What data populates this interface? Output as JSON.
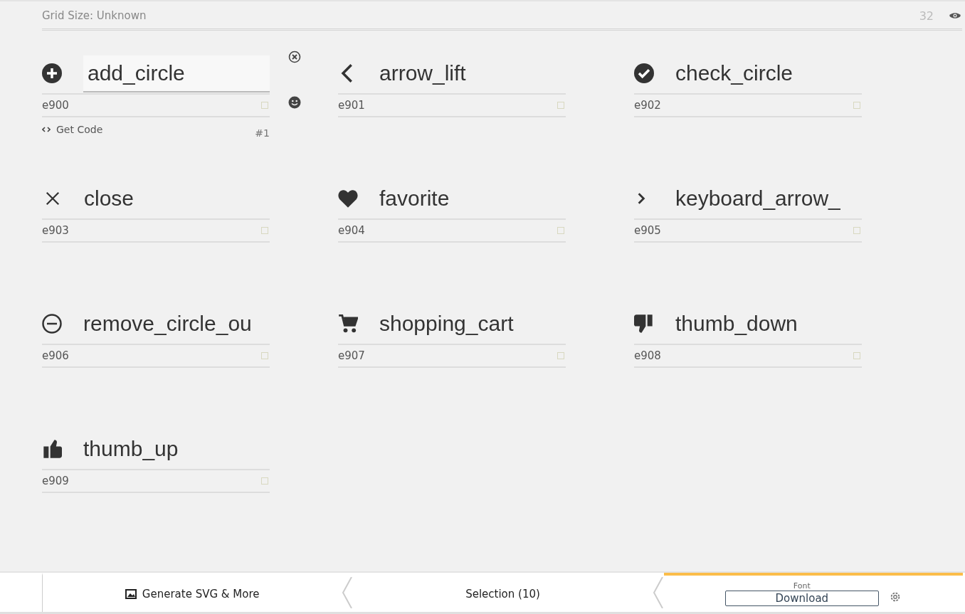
{
  "header": {
    "grid_size": "Grid Size: Unknown",
    "size": "32"
  },
  "glyphs": [
    {
      "kind": "plus_circle",
      "name": "add_circle",
      "code": "e900",
      "checked": false,
      "selected": true,
      "get_code": "Get Code",
      "index": "#1"
    },
    {
      "kind": "chevron_left",
      "name": "arrow_lift",
      "code": "e901",
      "checked": false,
      "selected": false
    },
    {
      "kind": "check_circle",
      "name": "check_circle",
      "code": "e902",
      "checked": false,
      "selected": false
    },
    {
      "kind": "cross",
      "name": "close",
      "code": "e903",
      "checked": false,
      "selected": false
    },
    {
      "kind": "heart",
      "name": "favorite",
      "code": "e904",
      "checked": false,
      "selected": false
    },
    {
      "kind": "chevron_right",
      "name": "keyboard_arrow_",
      "code": "e905",
      "checked": false,
      "selected": false
    },
    {
      "kind": "minus_circle",
      "name": "remove_circle_ou",
      "code": "e906",
      "checked": false,
      "selected": false
    },
    {
      "kind": "cart",
      "name": "shopping_cart",
      "code": "e907",
      "checked": false,
      "selected": false
    },
    {
      "kind": "thumbs_down",
      "name": "thumb_down",
      "code": "e908",
      "checked": false,
      "selected": false
    },
    {
      "kind": "thumbs_up",
      "name": "thumb_up",
      "code": "e909",
      "checked": false,
      "selected": false
    }
  ],
  "footer": {
    "tabs": [
      {
        "kind": "generate",
        "label": "Generate SVG & More",
        "selected": false
      },
      {
        "kind": "selection",
        "label": "Selection (10)",
        "selected": false
      },
      {
        "kind": "font",
        "label": "Font",
        "button": "Download",
        "selected": true
      }
    ]
  }
}
